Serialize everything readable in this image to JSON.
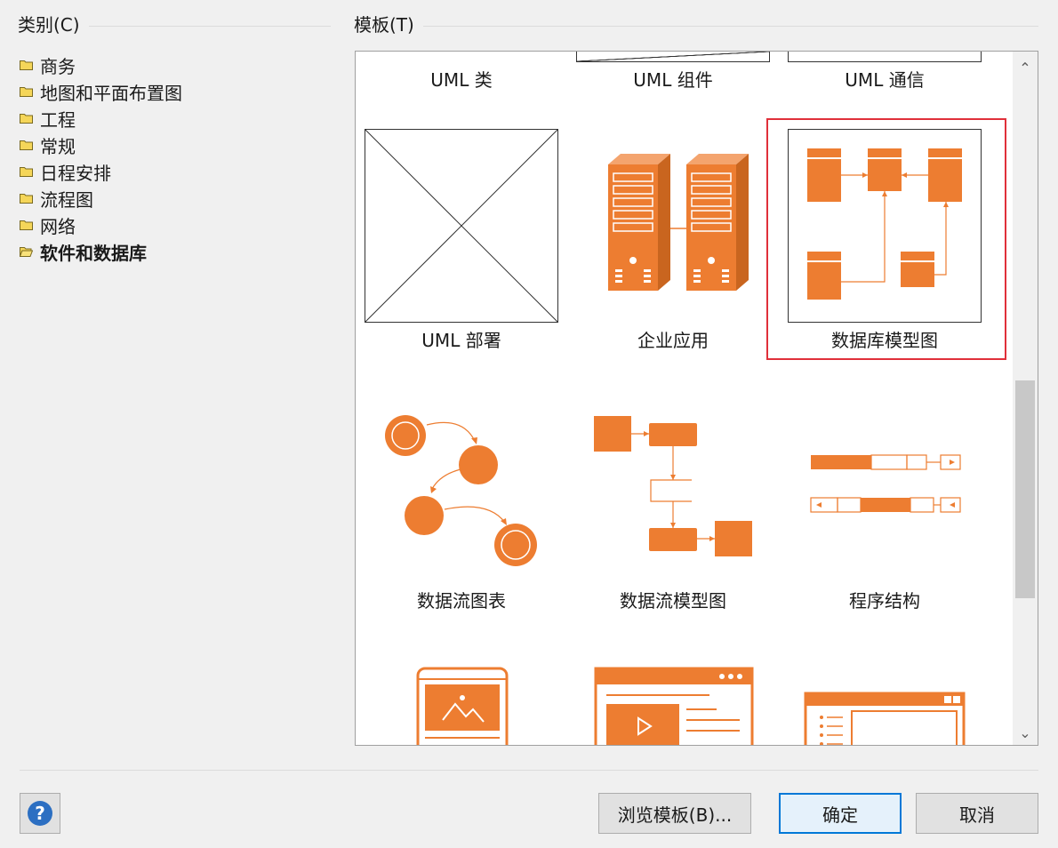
{
  "categories": {
    "title": "类别(C)",
    "items": [
      {
        "label": "商务",
        "selected": false
      },
      {
        "label": "地图和平面布置图",
        "selected": false
      },
      {
        "label": "工程",
        "selected": false
      },
      {
        "label": "常规",
        "selected": false
      },
      {
        "label": "日程安排",
        "selected": false
      },
      {
        "label": "流程图",
        "selected": false
      },
      {
        "label": "网络",
        "selected": false
      },
      {
        "label": "软件和数据库",
        "selected": true
      }
    ]
  },
  "templates": {
    "title": "模板(T)",
    "items": [
      {
        "label": "UML 类",
        "icon": "uml-class-icon"
      },
      {
        "label": "UML 组件",
        "icon": "uml-component-icon"
      },
      {
        "label": "UML 通信",
        "icon": "uml-communication-icon"
      },
      {
        "label": "UML 部署",
        "icon": "uml-deployment-placeholder-icon"
      },
      {
        "label": "企业应用",
        "icon": "enterprise-servers-icon"
      },
      {
        "label": "数据库模型图",
        "icon": "database-model-icon",
        "selected": true
      },
      {
        "label": "数据流图表",
        "icon": "data-flow-circles-icon"
      },
      {
        "label": "数据流模型图",
        "icon": "data-flow-model-icon"
      },
      {
        "label": "程序结构",
        "icon": "program-structure-icon"
      },
      {
        "label": "",
        "icon": "mobile-wireframe-icon"
      },
      {
        "label": "",
        "icon": "website-wireframe-icon"
      },
      {
        "label": "",
        "icon": "window-wireframe-icon"
      }
    ]
  },
  "buttons": {
    "browse": "浏览模板(B)...",
    "ok": "确定",
    "cancel": "取消",
    "help": "?"
  },
  "colors": {
    "accent": "#ed7d31",
    "selection": "#e0303a",
    "primary_border": "#0078d7"
  }
}
